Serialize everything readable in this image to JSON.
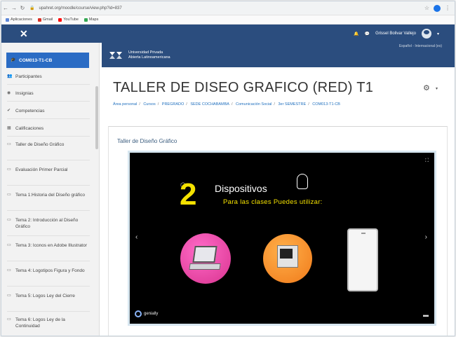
{
  "browser": {
    "url": "upahret.org/moodle/course/view.php?id=837",
    "bookmarks": [
      "Aplicaciones",
      "Gmail",
      "YouTube",
      "Maps"
    ]
  },
  "topbar": {
    "user_name": "Grissel Bolivar Vallejo"
  },
  "sidebar": {
    "active": "COM013-T1-CB",
    "items": [
      {
        "label": "Participantes",
        "icon": "users-icon"
      },
      {
        "label": "Insignias",
        "icon": "badge-icon"
      },
      {
        "label": "Competencias",
        "icon": "check-icon"
      },
      {
        "label": "Calificaciones",
        "icon": "grid-icon"
      },
      {
        "label": "Taller de Diseño Gráfico",
        "icon": "folder-icon"
      },
      {
        "label": "Evaluación Primer Parcial",
        "icon": "folder-icon"
      },
      {
        "label": "Tema 1:Historia del Diseño gráfico",
        "icon": "folder-icon"
      },
      {
        "label": "Tema 2: Introducción al Diseño Gráfico",
        "icon": "folder-icon"
      },
      {
        "label": "Tema 3: Iconos en Adobe Illustrator",
        "icon": "folder-icon"
      },
      {
        "label": "Tema 4: Logotipos Figura y Fondo",
        "icon": "folder-icon"
      },
      {
        "label": "Tema 5: Logos Ley del Cierre",
        "icon": "folder-icon"
      },
      {
        "label": "Tema 6: Logos Ley de la Continuidad",
        "icon": "folder-icon"
      }
    ]
  },
  "banner": {
    "line1": "Universidad Privada",
    "line2": "Abierta Latinoamericana",
    "right": "Español - Internacional (es)"
  },
  "course": {
    "title": "TALLER DE DISEO GRAFICO (RED) T1",
    "breadcrumb": [
      "Área personal",
      "Cursos",
      "PREGRADO",
      "SEDE COCHABAMBA",
      "Comunicación Social",
      "3er SEMESTRE",
      "COM013-T1-CB"
    ],
    "section_label": "Taller de Diseño Gráfico"
  },
  "slide": {
    "number": "2",
    "title": "Dispositivos",
    "subtitle": "Para las clases Puedes utilizar:",
    "brand": "genially"
  },
  "colors": {
    "navy": "#2b4d7e",
    "active_blue": "#2b6cc4",
    "slide_yellow": "#f4e100"
  }
}
